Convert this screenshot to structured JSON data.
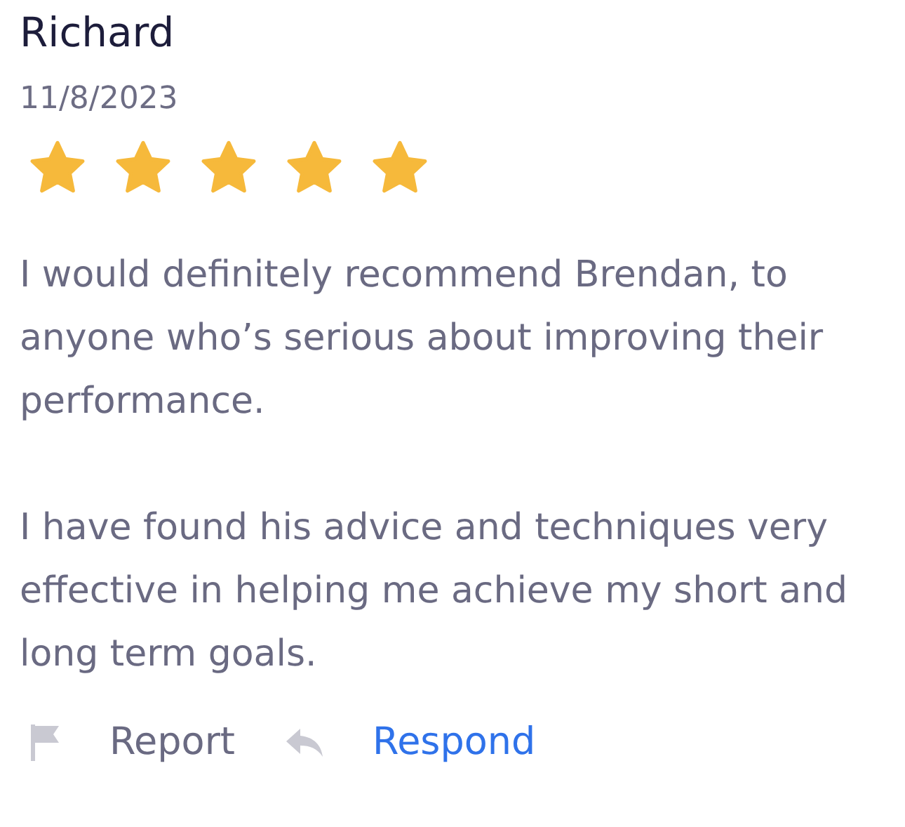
{
  "review": {
    "author": "Richard",
    "date": "11/8/2023",
    "stars": 5,
    "paragraphs": [
      "I would definitely recommend Brendan, to anyone who’s serious about improving their performance.",
      "I have found his advice and techniques very effective in helping me achieve my short and long term goals."
    ]
  },
  "actions": [
    {
      "kind": "report",
      "label": "Report"
    },
    {
      "kind": "respond",
      "label": "Respond"
    }
  ]
}
